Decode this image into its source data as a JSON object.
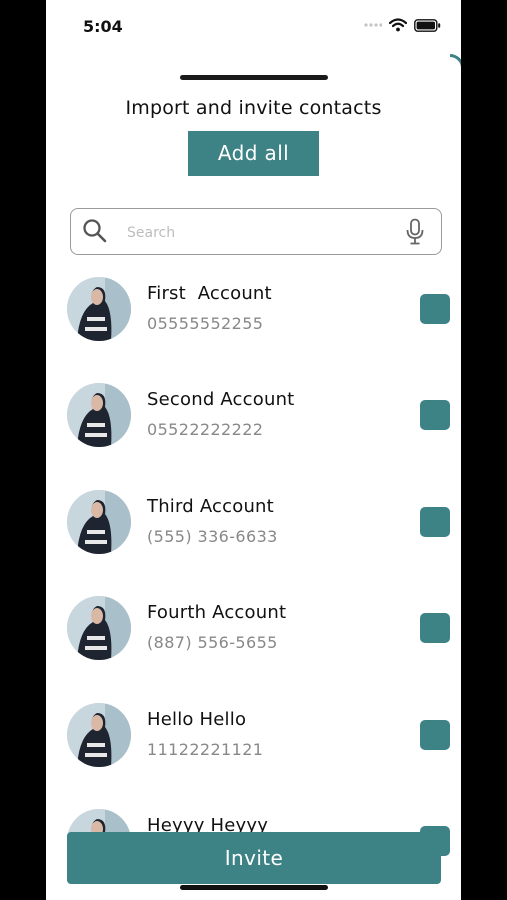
{
  "status_bar": {
    "time": "5:04"
  },
  "sheet": {
    "title": "Import and invite contacts",
    "add_all_label": "Add all"
  },
  "search": {
    "placeholder": "Search",
    "value": ""
  },
  "contacts": [
    {
      "name": "First  Account",
      "phone": "05555552255",
      "checked": true
    },
    {
      "name": "Second Account",
      "phone": "05522222222",
      "checked": true
    },
    {
      "name": "Third Account",
      "phone": "(555) 336-6633",
      "checked": true
    },
    {
      "name": "Fourth Account",
      "phone": "(887) 556-5655",
      "checked": true
    },
    {
      "name": "Hello Hello",
      "phone": "11122221121",
      "checked": true
    },
    {
      "name": "Heyyy Heyyy",
      "phone": "",
      "checked": true
    }
  ],
  "invite_label": "Invite",
  "colors": {
    "accent": "#3d8285",
    "background": "#ffffff"
  },
  "icons": [
    "search-icon",
    "microphone-icon",
    "wifi-icon",
    "battery-icon",
    "signal-icon"
  ]
}
